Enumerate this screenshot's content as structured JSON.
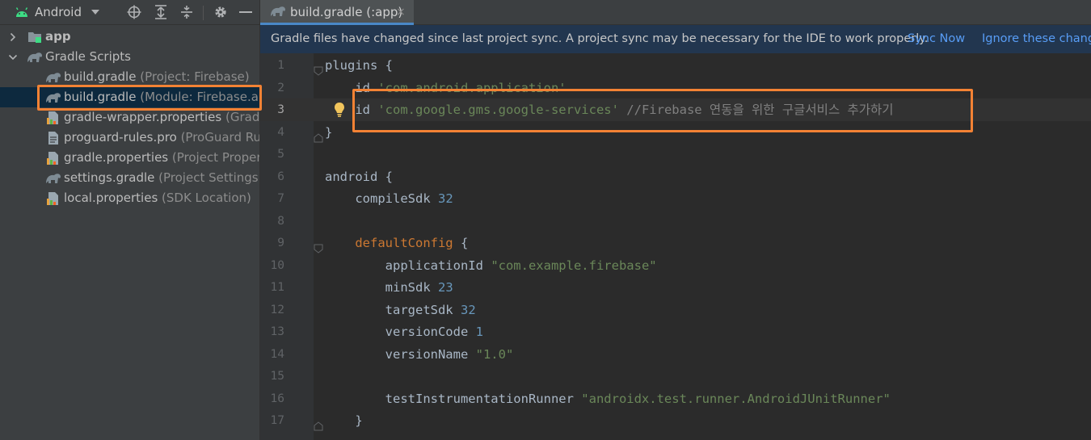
{
  "project_panel": {
    "view_label": "Android",
    "tree": [
      {
        "name": "app",
        "hint": "",
        "icon": "module-folder-icon",
        "bold": true,
        "chevron": "chevron-right-icon"
      },
      {
        "name": "Gradle Scripts",
        "hint": "",
        "icon": "gradle-icon",
        "bold": false,
        "chevron": "chevron-down-icon"
      },
      {
        "name": "build.gradle",
        "hint": "(Project: Firebase)",
        "icon": "gradle-icon"
      },
      {
        "name": "build.gradle",
        "hint": "(Module: Firebase.app)",
        "icon": "gradle-icon",
        "selected": true
      },
      {
        "name": "gradle-wrapper.properties",
        "hint": "(Gradle V",
        "icon": "properties-file-icon"
      },
      {
        "name": "proguard-rules.pro",
        "hint": "(ProGuard Rules",
        "icon": "text-file-icon"
      },
      {
        "name": "gradle.properties",
        "hint": "(Project Properties",
        "icon": "properties-file-icon"
      },
      {
        "name": "settings.gradle",
        "hint": "(Project Settings)",
        "icon": "gradle-icon"
      },
      {
        "name": "local.properties",
        "hint": "(SDK Location)",
        "icon": "properties-file-icon"
      }
    ]
  },
  "editor": {
    "tab_title": "build.gradle (:app)",
    "tab_close": "×",
    "notification": {
      "message": "Gradle files have changed since last project sync. A project sync may be necessary for the IDE to work properly.",
      "sync_now": "Sync Now",
      "ignore": "Ignore these changes"
    },
    "lines": [
      {
        "num": "1",
        "tokens": [
          {
            "t": "plugins {",
            "c": "k"
          }
        ]
      },
      {
        "num": "2",
        "tokens": [
          {
            "t": "    id ",
            "c": "k"
          },
          {
            "t": "'com.android.application'",
            "c": "s"
          }
        ]
      },
      {
        "num": "3",
        "tokens": [
          {
            "t": "    id ",
            "c": "k"
          },
          {
            "t": "'com.google.gms.google-services'",
            "c": "s"
          },
          {
            "t": " //Firebase 연동을 위한 구글서비스 추가하기",
            "c": "c"
          }
        ]
      },
      {
        "num": "4",
        "tokens": [
          {
            "t": "}",
            "c": "k"
          }
        ]
      },
      {
        "num": "5",
        "tokens": []
      },
      {
        "num": "6",
        "tokens": [
          {
            "t": "android {",
            "c": "k"
          }
        ]
      },
      {
        "num": "7",
        "tokens": [
          {
            "t": "    compileSdk ",
            "c": "k"
          },
          {
            "t": "32",
            "c": "n"
          }
        ]
      },
      {
        "num": "8",
        "tokens": []
      },
      {
        "num": "9",
        "tokens": [
          {
            "t": "    ",
            "c": "k"
          },
          {
            "t": "defaultConfig",
            "c": "kw2"
          },
          {
            "t": " {",
            "c": "k"
          }
        ]
      },
      {
        "num": "10",
        "tokens": [
          {
            "t": "        applicationId ",
            "c": "k"
          },
          {
            "t": "\"com.example.firebase\"",
            "c": "s"
          }
        ]
      },
      {
        "num": "11",
        "tokens": [
          {
            "t": "        minSdk ",
            "c": "k"
          },
          {
            "t": "23",
            "c": "n"
          }
        ]
      },
      {
        "num": "12",
        "tokens": [
          {
            "t": "        targetSdk ",
            "c": "k"
          },
          {
            "t": "32",
            "c": "n"
          }
        ]
      },
      {
        "num": "13",
        "tokens": [
          {
            "t": "        versionCode ",
            "c": "k"
          },
          {
            "t": "1",
            "c": "n"
          }
        ]
      },
      {
        "num": "14",
        "tokens": [
          {
            "t": "        versionName ",
            "c": "k"
          },
          {
            "t": "\"1.0\"",
            "c": "s"
          }
        ]
      },
      {
        "num": "15",
        "tokens": []
      },
      {
        "num": "16",
        "tokens": [
          {
            "t": "        testInstrumentationRunner ",
            "c": "k"
          },
          {
            "t": "\"androidx.test.runner.AndroidJUnitRunner\"",
            "c": "s"
          }
        ]
      },
      {
        "num": "17",
        "tokens": [
          {
            "t": "    }",
            "c": "k"
          }
        ]
      }
    ]
  },
  "colors": {
    "highlight": "#f38234",
    "string": "#6a8759",
    "number": "#6897bb",
    "comment": "#808080",
    "link": "#589df6",
    "selection": "#0d293e"
  }
}
